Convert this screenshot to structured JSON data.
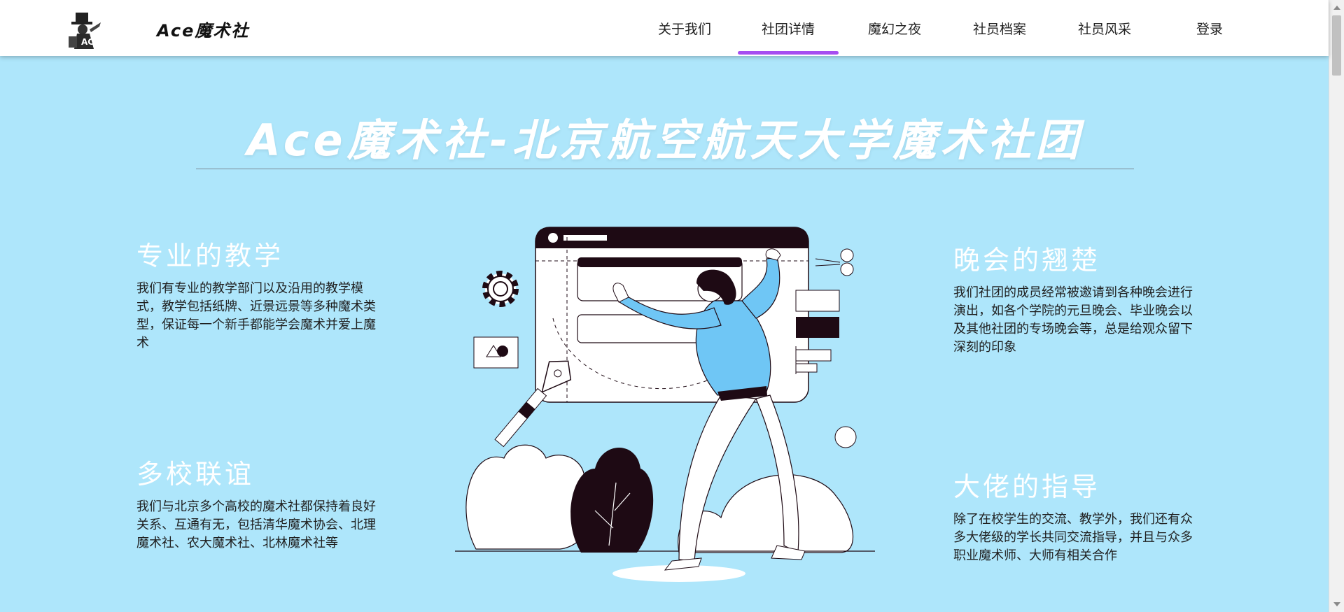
{
  "site": {
    "brand": "Ace魔术社"
  },
  "nav": {
    "items": [
      {
        "label": "关于我们",
        "active": false
      },
      {
        "label": "社团详情",
        "active": true
      },
      {
        "label": "魔幻之夜",
        "active": false
      },
      {
        "label": "社员档案",
        "active": false
      },
      {
        "label": "社员风采",
        "active": false
      }
    ],
    "login": "登录"
  },
  "hero": {
    "title": "Ace魔术社-北京航空航天大学魔术社团"
  },
  "features": [
    {
      "title": "专业的教学",
      "text": "我们有专业的教学部门以及沿用的教学模式，教学包括纸牌、近景远景等多种魔术类型，保证每一个新手都能学会魔术并爱上魔术"
    },
    {
      "title": "晚会的翘楚",
      "text": "我们社团的成员经常被邀请到各种晚会进行演出，如各个学院的元旦晚会、毕业晚会以及其他社团的专场晚会等，总是给观众留下深刻的印象"
    },
    {
      "title": "多校联谊",
      "text": "我们与北京多个高校的魔术社都保持着良好关系、互通有无，包括清华魔术协会、北理魔术社、农大魔术社、北林魔术社等"
    },
    {
      "title": "大佬的指导",
      "text": "除了在校学生的交流、教学外，我们还有众多大佬级的学长共同交流指导，并且与众多职业魔术师、大师有相关合作"
    }
  ],
  "colors": {
    "background": "#aee6fb",
    "accent": "#a64df0",
    "figure_blue": "#6fc6f5",
    "dark": "#1e0a14"
  }
}
